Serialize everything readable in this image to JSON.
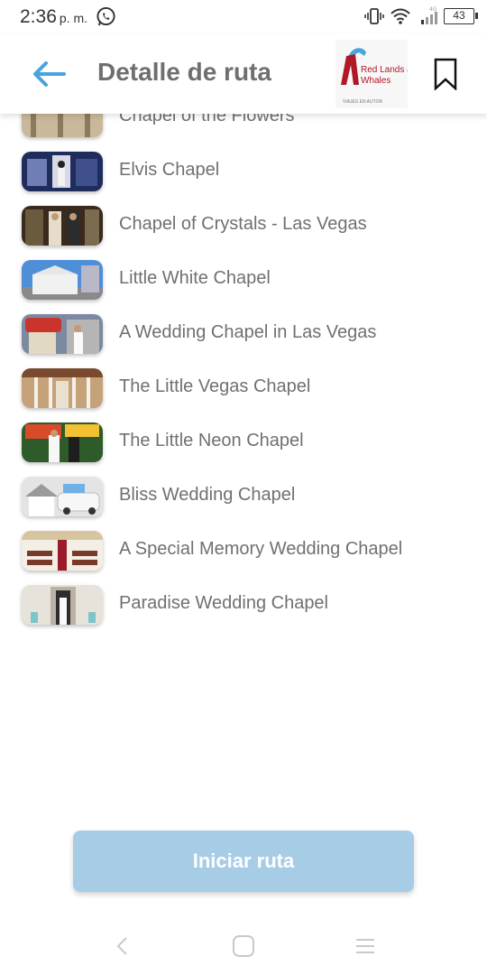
{
  "status_bar": {
    "time": "2:36",
    "ampm": "p. m.",
    "battery": "43",
    "icons": [
      "whatsapp-icon",
      "vibrate-icon",
      "wifi-icon",
      "signal-icon",
      "battery-icon"
    ]
  },
  "header": {
    "title": "Detalle de ruta",
    "back_icon": "arrow-left-icon",
    "bookmark_icon": "bookmark-icon",
    "logo": {
      "line1": "Red Lands and",
      "line2": "Whales",
      "tagline": "VIAJES EN AUTOR"
    }
  },
  "route_list": {
    "items": [
      {
        "name": "Chapel of the Flowers"
      },
      {
        "name": "Elvis Chapel"
      },
      {
        "name": "Chapel of Crystals - Las Vegas"
      },
      {
        "name": "Little White Chapel"
      },
      {
        "name": "A Wedding Chapel in Las Vegas"
      },
      {
        "name": "The Little Vegas Chapel"
      },
      {
        "name": "The Little Neon Chapel"
      },
      {
        "name": "Bliss Wedding Chapel"
      },
      {
        "name": "A Special Memory Wedding Chapel"
      },
      {
        "name": "Paradise Wedding Chapel"
      }
    ]
  },
  "actions": {
    "start_label": "Iniciar ruta"
  },
  "colors": {
    "accent": "#4aa3df",
    "button_bg": "#a7cde6",
    "title_text": "#6f6f6f",
    "item_text": "#707070"
  }
}
